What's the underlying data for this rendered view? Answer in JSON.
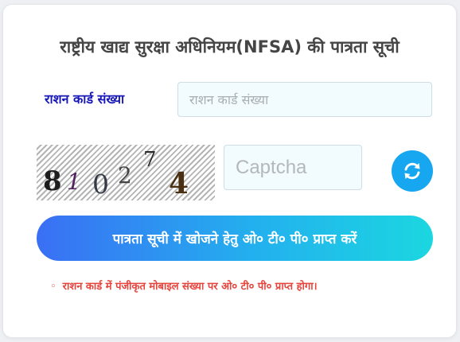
{
  "title": "राष्ट्रीय खाद्य सुरक्षा अधिनियम(NFSA) की पात्रता सूची",
  "ration_field": {
    "label": "राशन कार्ड संख्या",
    "placeholder": "राशन कार्ड संख्या",
    "value": ""
  },
  "captcha": {
    "characters": [
      "8",
      "1",
      "0",
      "2",
      "7",
      "4"
    ],
    "input_placeholder": "Captcha",
    "input_value": "",
    "refresh_icon": "refresh-icon"
  },
  "otp_button_label": "पात्रता सूची में खोजने हेतु ओ० टी० पी० प्राप्त करें",
  "note": {
    "bullet": "◦",
    "text": "राशन कार्ड में पंजीकृत मोबाइल संख्या पर ओ० टी० पी० प्राप्त होगा।"
  },
  "colors": {
    "label": "#1818b8",
    "note": "#e5453d",
    "refresh": "#17a7f0",
    "button_gradient": [
      "#3a6ff4",
      "#1bd7e0"
    ]
  }
}
